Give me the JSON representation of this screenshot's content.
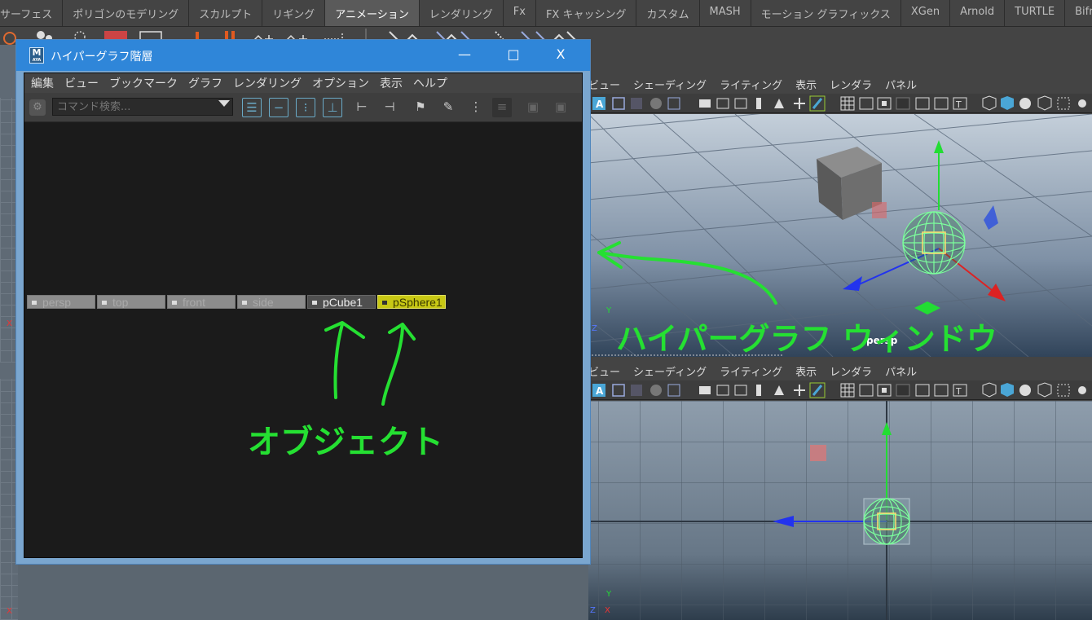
{
  "shelf": {
    "tabs": [
      {
        "label": "サーフェス",
        "active": false
      },
      {
        "label": "ポリゴンのモデリング",
        "active": false
      },
      {
        "label": "スカルプト",
        "active": false
      },
      {
        "label": "リギング",
        "active": false
      },
      {
        "label": "アニメーション",
        "active": true
      },
      {
        "label": "レンダリング",
        "active": false
      },
      {
        "label": "Fx",
        "active": false
      },
      {
        "label": "FX キャッシング",
        "active": false
      },
      {
        "label": "カスタム",
        "active": false
      },
      {
        "label": "MASH",
        "active": false
      },
      {
        "label": "モーション グラフィックス",
        "active": false
      },
      {
        "label": "XGen",
        "active": false
      },
      {
        "label": "Arnold",
        "active": false
      },
      {
        "label": "TURTLE",
        "active": false
      },
      {
        "label": "Bifrost",
        "active": false
      }
    ]
  },
  "viewport_menu": {
    "items": [
      "ビュー",
      "シェーディング",
      "ライティング",
      "表示",
      "レンダラ",
      "パネル"
    ]
  },
  "viewport_top": {
    "camera": "persp",
    "axis_y": "Y",
    "axis_z": "Z",
    "axis_x": "X"
  },
  "viewport_bottom": {
    "axis_y": "Y",
    "axis_z": "Z",
    "axis_x": "X"
  },
  "left_strip_axis": "X",
  "hypergraph": {
    "title": "ハイパーグラフ階層",
    "logo": "M",
    "logo_sub": "AYA",
    "minimize_glyph": "—",
    "maximize_glyph": "□",
    "close_glyph": "X",
    "menu": [
      "編集",
      "ビュー",
      "ブックマーク",
      "グラフ",
      "レンダリング",
      "オプション",
      "表示",
      "ヘルプ"
    ],
    "search_placeholder": "コマンド検索...",
    "nodes": [
      {
        "label": "persp",
        "kind": "camera"
      },
      {
        "label": "top",
        "kind": "camera"
      },
      {
        "label": "front",
        "kind": "camera"
      },
      {
        "label": "side",
        "kind": "camera"
      },
      {
        "label": "pCube1",
        "kind": "object"
      },
      {
        "label": "pSphere1",
        "kind": "selected"
      }
    ]
  },
  "annotations": {
    "window_label": "ハイパーグラフ ウィンドウ",
    "object_label": "オブジェクト"
  },
  "colors": {
    "annotation": "#25e032",
    "title_bar": "#2f86d9",
    "selected_node": "#c8c814",
    "sphere_wire": "#7cff9c"
  }
}
